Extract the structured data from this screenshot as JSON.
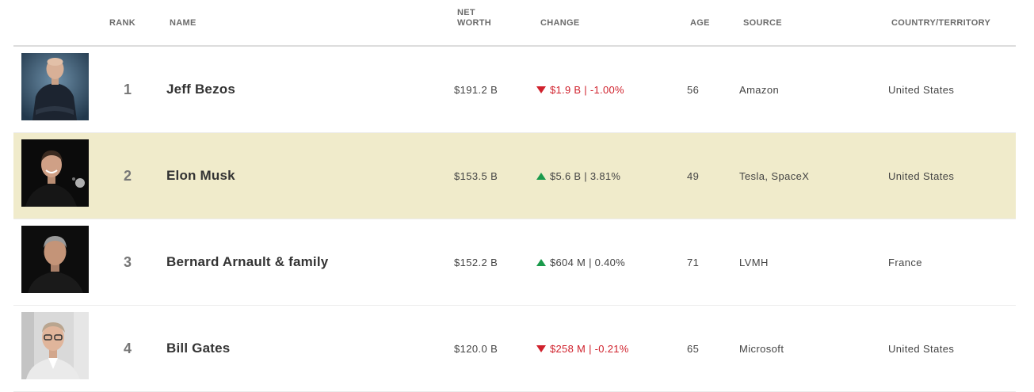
{
  "columns": {
    "rank": "RANK",
    "name": "NAME",
    "net_worth_line1": "NET",
    "net_worth_line2": "WORTH",
    "change": "CHANGE",
    "age": "AGE",
    "source": "SOURCE",
    "country": "COUNTRY/TERRITORY"
  },
  "colors": {
    "down": "#d0212c",
    "up": "#1a9a4b",
    "highlight_row": "#f0ebcb"
  },
  "rows": [
    {
      "rank": "1",
      "name": "Jeff Bezos",
      "net_worth": "$191.2 B",
      "change": "$1.9 B | -1.00%",
      "direction": "down",
      "age": "56",
      "source": "Amazon",
      "country": "United States"
    },
    {
      "rank": "2",
      "name": "Elon Musk",
      "net_worth": "$153.5 B",
      "change": "$5.6 B | 3.81%",
      "direction": "up",
      "age": "49",
      "source": "Tesla, SpaceX",
      "country": "United States"
    },
    {
      "rank": "3",
      "name": "Bernard Arnault & family",
      "net_worth": "$152.2 B",
      "change": "$604 M | 0.40%",
      "direction": "up",
      "age": "71",
      "source": "LVMH",
      "country": "France"
    },
    {
      "rank": "4",
      "name": "Bill Gates",
      "net_worth": "$120.0 B",
      "change": "$258 M | -0.21%",
      "direction": "down",
      "age": "65",
      "source": "Microsoft",
      "country": "United States"
    }
  ]
}
